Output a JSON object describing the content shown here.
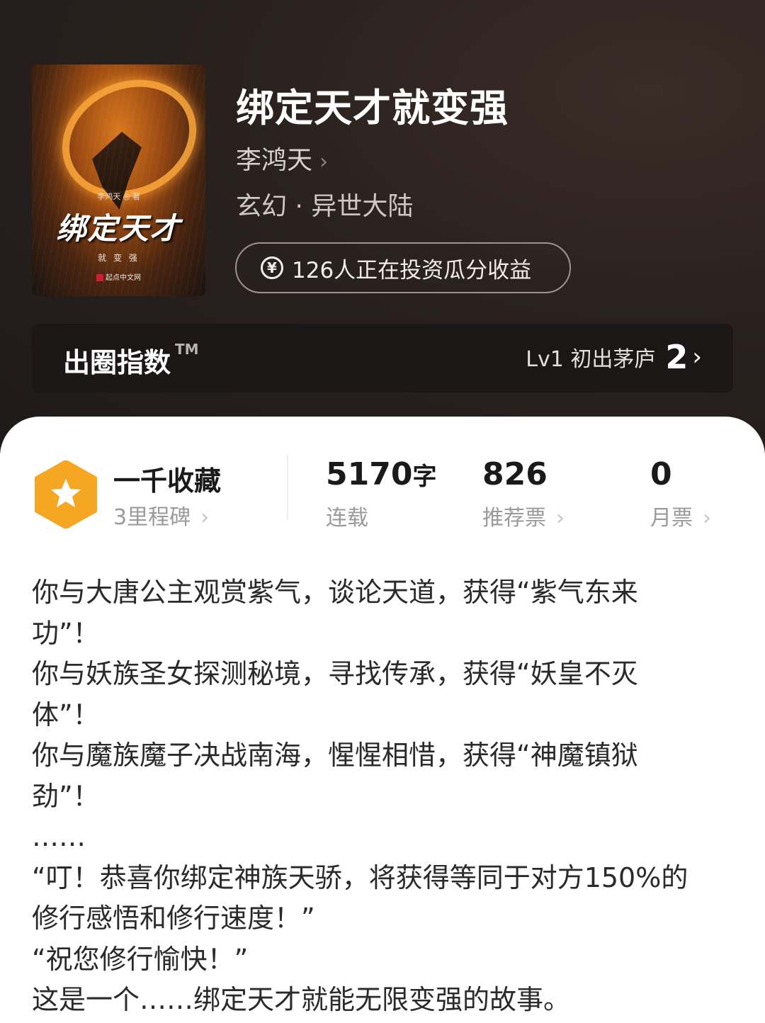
{
  "cover": {
    "author_line": "李鸿天 ◎ 著",
    "title_art": "绑定天才",
    "subtitle_art": "就 变 强",
    "publisher": "起点中文网"
  },
  "book": {
    "title": "绑定天才就变强",
    "author": "李鸿天",
    "genre": "玄幻 · 异世大陆",
    "invest_text": "126人正在投资瓜分收益",
    "invest_icon": "¥"
  },
  "index": {
    "title": "出圈指数",
    "tm": "TM",
    "level": "Lv1 初出茅庐",
    "score": "2"
  },
  "milestone": {
    "name": "一千收藏",
    "sub": "3里程碑"
  },
  "stats": [
    {
      "value": "5170",
      "unit": "字",
      "label": "连载"
    },
    {
      "value": "826",
      "label": "推荐票"
    },
    {
      "value": "0",
      "label": "月票"
    }
  ],
  "synopsis": [
    "你与大唐公主观赏紫气，谈论天道，获得“紫气东来",
    "功”！",
    "你与妖族圣女探测秘境，寻找传承，获得“妖皇不灭",
    "体”！",
    "你与魔族魔子决战南海，惺惺相惜，获得“神魔镇狱",
    "劲”！",
    "……",
    "“叮！恭喜你绑定神族天骄，将获得等同于对方150%的",
    "修行感悟和修行速度！”",
    "“祝您修行愉快！”",
    "这是一个……绑定天才就能无限变强的故事。"
  ],
  "colors": {
    "header_bg": "#2b221f",
    "accent_orange": "#f5a623",
    "text_dark": "#1a1a1a",
    "text_gray": "#9a9a9a"
  }
}
